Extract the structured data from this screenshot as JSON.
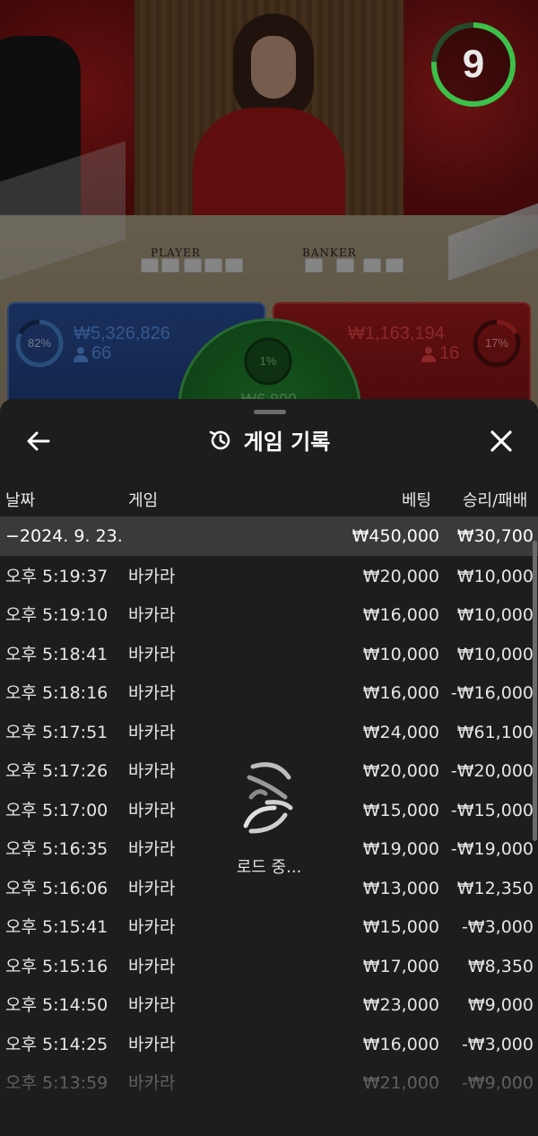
{
  "game_view": {
    "countdown": "9",
    "player_label": "PLAYER",
    "banker_label": "BANKER",
    "player": {
      "percent": "82%",
      "amount": "₩5,326,826",
      "players": "66"
    },
    "banker": {
      "percent": "17%",
      "amount": "₩1,163,194",
      "players": "16"
    },
    "tie": {
      "percent": "1%",
      "amount": "₩6,800"
    },
    "colors": {
      "player": "#4a90e2",
      "banker": "#e03030",
      "tie": "#3fbf4f",
      "timer": "#3cc04a"
    }
  },
  "sheet": {
    "title": "게임 기록",
    "icons": {
      "back": "arrow-left-icon",
      "history": "history-icon",
      "close": "close-icon"
    },
    "columns": {
      "date": "날짜",
      "game": "게임",
      "bet": "베팅",
      "result": "승리/패배"
    },
    "summary": {
      "date": "−2024. 9. 23.",
      "bet": "₩450,000",
      "result": "₩30,700"
    },
    "rows": [
      {
        "time": "오후 5:19:37",
        "game": "바카라",
        "bet": "₩20,000",
        "result": "₩10,000"
      },
      {
        "time": "오후 5:19:10",
        "game": "바카라",
        "bet": "₩16,000",
        "result": "₩10,000"
      },
      {
        "time": "오후 5:18:41",
        "game": "바카라",
        "bet": "₩10,000",
        "result": "₩10,000"
      },
      {
        "time": "오후 5:18:16",
        "game": "바카라",
        "bet": "₩16,000",
        "result": "-₩16,000"
      },
      {
        "time": "오후 5:17:51",
        "game": "바카라",
        "bet": "₩24,000",
        "result": "₩61,100"
      },
      {
        "time": "오후 5:17:26",
        "game": "바카라",
        "bet": "₩20,000",
        "result": "-₩20,000"
      },
      {
        "time": "오후 5:17:00",
        "game": "바카라",
        "bet": "₩15,000",
        "result": "-₩15,000"
      },
      {
        "time": "오후 5:16:35",
        "game": "바카라",
        "bet": "₩19,000",
        "result": "-₩19,000"
      },
      {
        "time": "오후 5:16:06",
        "game": "바카라",
        "bet": "₩13,000",
        "result": "₩12,350"
      },
      {
        "time": "오후 5:15:41",
        "game": "바카라",
        "bet": "₩15,000",
        "result": "-₩3,000"
      },
      {
        "time": "오후 5:15:16",
        "game": "바카라",
        "bet": "₩17,000",
        "result": "₩8,350"
      },
      {
        "time": "오후 5:14:50",
        "game": "바카라",
        "bet": "₩23,000",
        "result": "₩9,000"
      },
      {
        "time": "오후 5:14:25",
        "game": "바카라",
        "bet": "₩16,000",
        "result": "-₩3,000"
      },
      {
        "time": "오후 5:13:59",
        "game": "바카라",
        "bet": "₩21,000",
        "result": "-₩9,000"
      }
    ],
    "loading_text": "로드 중..."
  }
}
